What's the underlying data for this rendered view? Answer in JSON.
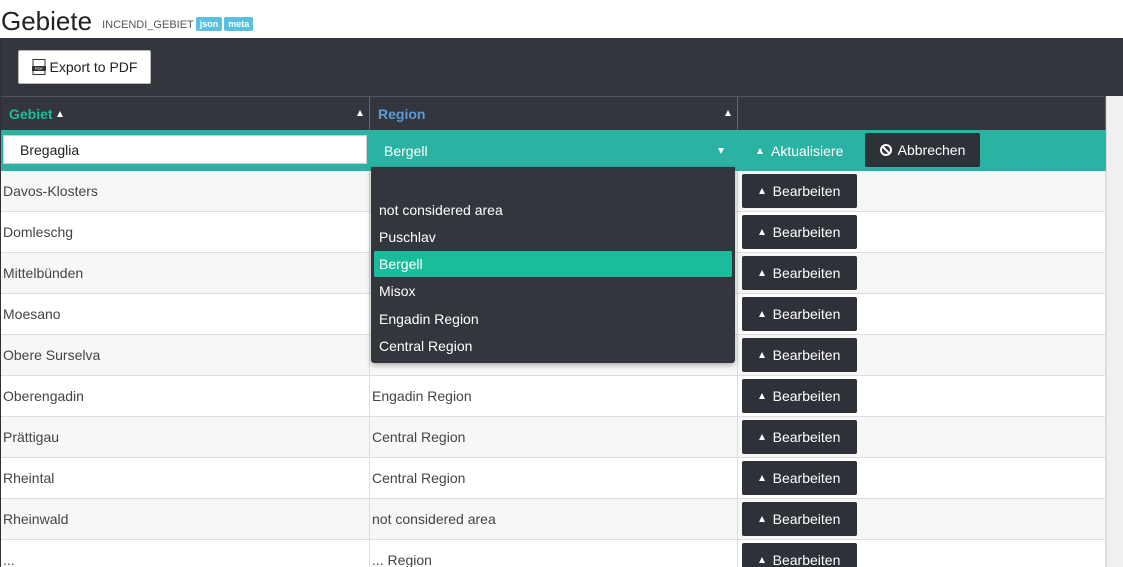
{
  "header": {
    "title": "Gebiete",
    "subtitle": "INCENDI_GEBIET",
    "badges": [
      "json",
      "meta"
    ]
  },
  "toolbar": {
    "export_label": "Export to PDF",
    "export_icon": "pdf-icon"
  },
  "table": {
    "columns": [
      "Gebiet",
      "Region"
    ],
    "edit_row": {
      "gebiet_value": "Bregaglia",
      "region_value": "Bergell",
      "update_label": "Aktualisiere",
      "cancel_label": "Abbrechen"
    },
    "rows": [
      {
        "gebiet": "Davos-Klosters",
        "region": ""
      },
      {
        "gebiet": "Domleschg",
        "region": ""
      },
      {
        "gebiet": "Mittelbünden",
        "region": ""
      },
      {
        "gebiet": "Moesano",
        "region": ""
      },
      {
        "gebiet": "Obere Surselva",
        "region": ""
      },
      {
        "gebiet": "Oberengadin",
        "region": "Engadin Region"
      },
      {
        "gebiet": "Prättigau",
        "region": "Central Region"
      },
      {
        "gebiet": "Rheintal",
        "region": "Central Region"
      },
      {
        "gebiet": "Rheinwald",
        "region": "not considered area"
      },
      {
        "gebiet": "...",
        "region": "... Region"
      }
    ],
    "edit_label": "Bearbeiten"
  },
  "dropdown": {
    "options": [
      "",
      "not considered area",
      "Puschlav",
      "Bergell",
      "Misox",
      "Engadin Region",
      "Central Region"
    ],
    "selected": "Bergell"
  },
  "colors": {
    "accent": "#1abc9c",
    "edit_row": "#2ab3a3",
    "dark": "#34363d",
    "region_header": "#5b9bd5"
  }
}
